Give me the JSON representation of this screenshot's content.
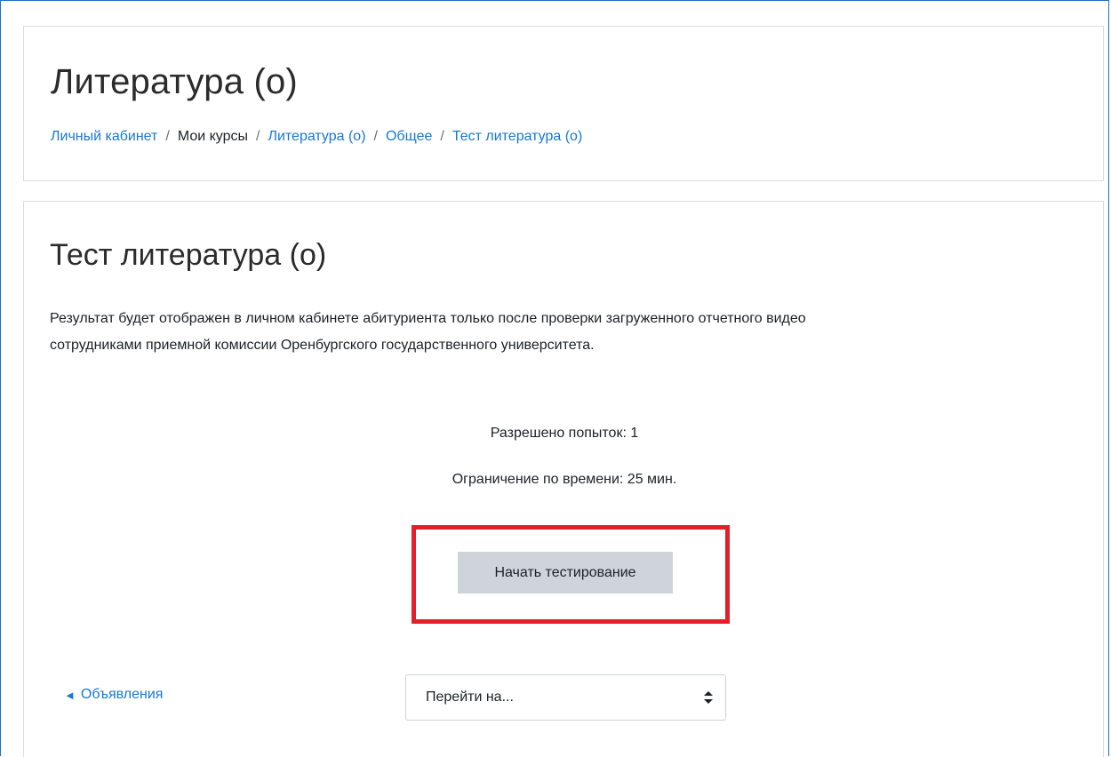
{
  "header": {
    "course_title": "Литература (о)",
    "breadcrumb": {
      "item1": "Личный кабинет",
      "item2": "Мои курсы",
      "item3": "Литература (о)",
      "item4": "Общее",
      "item5": "Тест литература (о)",
      "separator": "/"
    }
  },
  "quiz": {
    "title": "Тест литература (о)",
    "intro_line1": "Результат будет отображен в личном кабинете абитуриента только после проверки загруженного отчетного видео",
    "intro_line2": "сотрудниками приемной комиссии Оренбургского государственного университета.",
    "attempts_text": "Разрешено попыток: 1",
    "time_limit_text": "Ограничение по времени: 25 мин.",
    "start_button_label": "Начать тестирование",
    "highlight_color": "#e3202a"
  },
  "navigation": {
    "prev_link_label": "Объявления",
    "prev_link_icon": "arrow-left-icon",
    "jump_select_value": "Перейти на..."
  },
  "colors": {
    "link": "#1877d3",
    "button_bg": "#ced4da",
    "frame_border": "#1f6fc5"
  }
}
